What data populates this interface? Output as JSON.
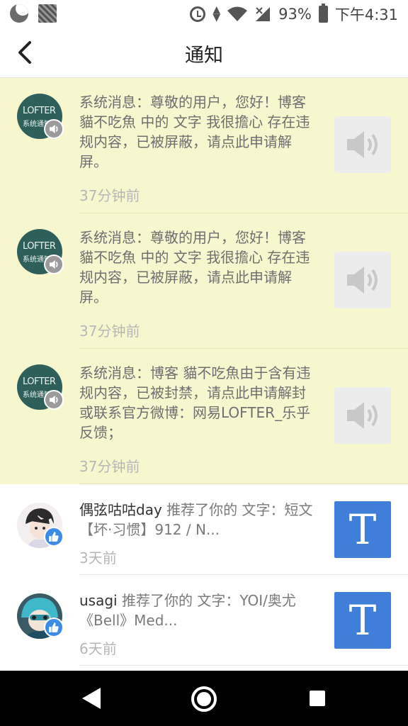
{
  "status_bar": {
    "battery": "93%",
    "time": "下午4:31"
  },
  "header": {
    "title": "通知"
  },
  "system_avatar": {
    "logo": "LOFTER",
    "sub": "系统通知"
  },
  "notifications": [
    {
      "type": "system",
      "text": "系统消息：尊敬的用户，您好！博客 貓不吃魚 中的 文字 我很擔心 存在违规内容，已被屏蔽，请点此申请解屏。",
      "time": "37分钟前"
    },
    {
      "type": "system",
      "text": "系统消息：尊敬的用户，您好！博客 貓不吃魚 中的 文字 我很擔心 存在违规内容，已被屏蔽，请点此申请解屏。",
      "time": "37分钟前"
    },
    {
      "type": "system",
      "text": "系统消息：博客 貓不吃魚由于含有违规内容，已被封禁，请点此申请解封 或联系官方微博：网易LOFTER_乐乎反馈；",
      "time": "37分钟前"
    },
    {
      "type": "recommend",
      "user": "偶弦咕咕day",
      "text": " 推荐了你的 文字：短文【坏·习惯】912 / N...",
      "time": "3天前",
      "thumb": "T"
    },
    {
      "type": "recommend",
      "user": "usagi",
      "text": " 推荐了你的 文字：YOI/奥尤《Bell》Med...",
      "time": "6天前",
      "thumb": "T"
    }
  ],
  "colors": {
    "system_bg": "#f6f7cf",
    "accent_blue": "#3f7fd9",
    "logo_green": "#2f5f5b"
  },
  "icons": {
    "back": "chevron-left-icon",
    "speaker": "speaker-icon",
    "like": "thumbs-up-icon"
  }
}
